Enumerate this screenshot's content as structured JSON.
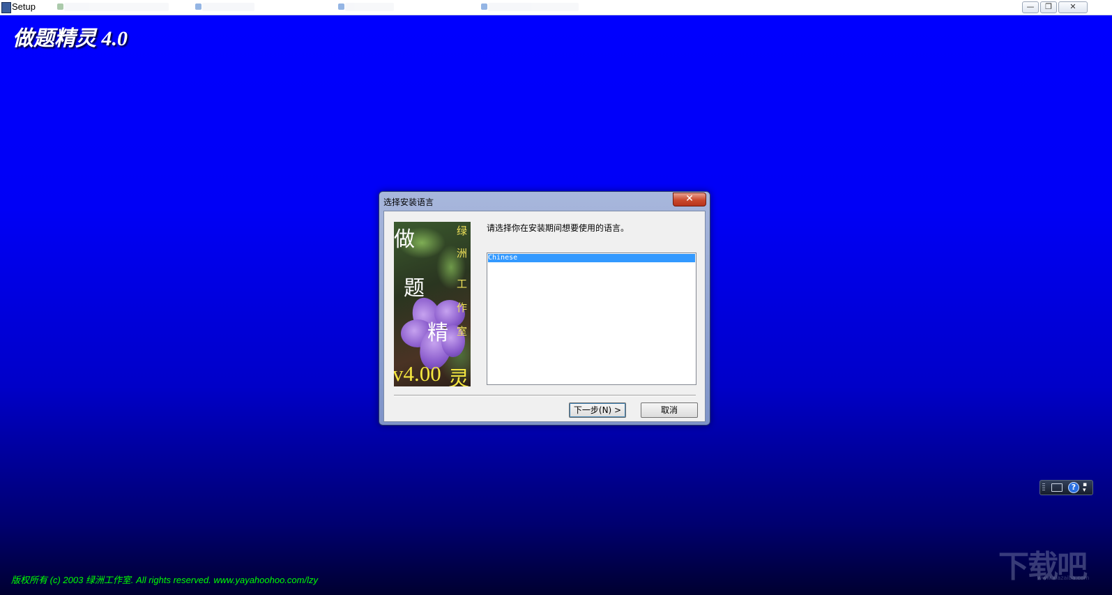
{
  "window": {
    "title": "Setup",
    "controls": [
      "minimize",
      "restore",
      "close"
    ]
  },
  "installer": {
    "product_title": "做题精灵 4.0",
    "copyright": "版权所有 (c) 2003 绿洲工作室. All rights reserved. www.yayahoohoo.com/lzy"
  },
  "dialog": {
    "title": "选择安装语言",
    "close_glyph": "✕",
    "prompt": "请选择你在安装期间想要使用的语言。",
    "languages": [
      "Chinese"
    ],
    "selected_language": "Chinese",
    "next_label": "下一步(N) >",
    "cancel_label": "取消",
    "splash": {
      "vertical_title": [
        "做",
        "题",
        "精"
      ],
      "studio": [
        "绿",
        "洲",
        "工",
        "作",
        "室"
      ],
      "version": "v4.00",
      "last_char": "灵"
    }
  },
  "ime": {
    "help_glyph": "?",
    "menu_glyph": "▪\n▾"
  },
  "watermark": {
    "text": "下载吧",
    "url": "www.xiazaiba.com"
  },
  "colors": {
    "desktop_top": "#0000ff",
    "desktop_bottom": "#000030",
    "copyright_text": "#00ff00",
    "selection": "#3399ff",
    "close_button": "#c9482c"
  }
}
